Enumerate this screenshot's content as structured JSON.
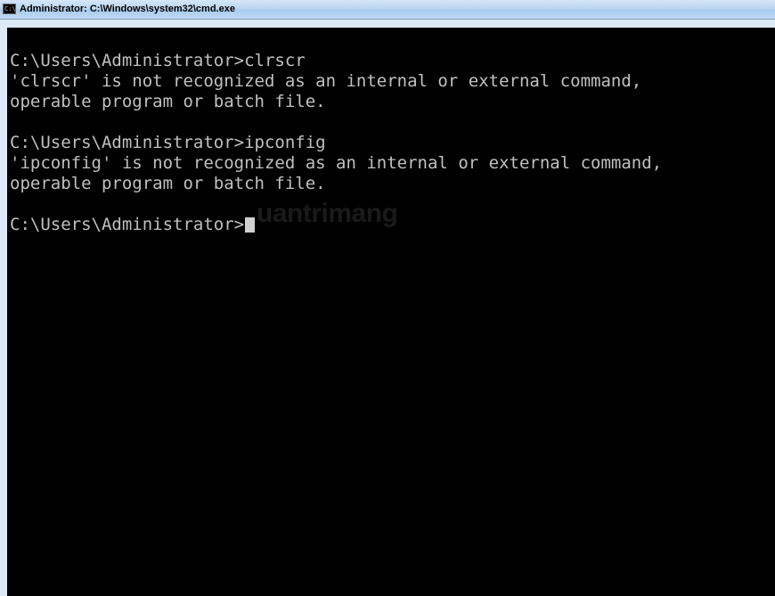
{
  "window": {
    "title": "Administrator: C:\\Windows\\system32\\cmd.exe",
    "icon": "cmd-console-icon",
    "icon_glyph": "C:\\."
  },
  "console": {
    "background": "#000000",
    "foreground": "#c0c0c0",
    "lines": [
      "C:\\Users\\Administrator>clrscr",
      "'clrscr' is not recognized as an internal or external command,",
      "operable program or batch file.",
      "",
      "C:\\Users\\Administrator>ipconfig",
      "'ipconfig' is not recognized as an internal or external command,",
      "operable program or batch file.",
      "",
      "C:\\Users\\Administrator>"
    ]
  },
  "watermark": {
    "text": "uantrimang"
  }
}
